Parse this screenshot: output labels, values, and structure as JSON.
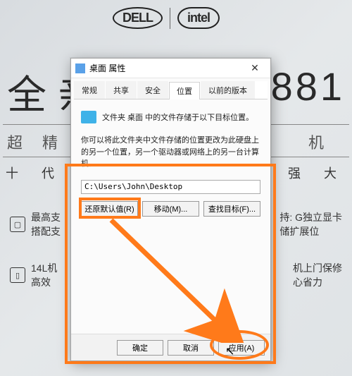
{
  "background": {
    "logo_dell": "D⁠ELL",
    "logo_intel": "intel",
    "headline_left": "全 亲",
    "headline_right": "881",
    "sub_left": "超",
    "sub_mid": "精",
    "sub_right": "式 机",
    "tagline_left": "十 代",
    "tagline_right": "的 强 大",
    "spec1a": "最高支",
    "spec1b": "搭配支",
    "spec1r_a": "持: G独立显卡",
    "spec1r_b": "储扩展位",
    "spec2a": "14L机",
    "spec2b": "高效",
    "spec2r_a": "机上门保修",
    "spec2r_b": "心省力"
  },
  "dialog": {
    "title": "桌面 属性",
    "tabs": {
      "general": "常规",
      "share": "共享",
      "security": "安全",
      "location": "位置",
      "previous": "以前的版本"
    },
    "line1": "文件夹 桌面 中的文件存储于以下目标位置。",
    "info": "你可以将此文件夹中文件存储的位置更改为此硬盘上的另一个位置，另一个驱动器或网络上的另一台计算机。",
    "path": "C:\\Users\\John\\Desktop",
    "btn_restore": "还原默认值(R)",
    "btn_move": "移动(M)...",
    "btn_find": "查找目标(F)...",
    "btn_ok": "确定",
    "btn_cancel": "取消",
    "btn_apply": "应用(A)"
  },
  "annotation": {
    "color": "#ff7a1a"
  }
}
